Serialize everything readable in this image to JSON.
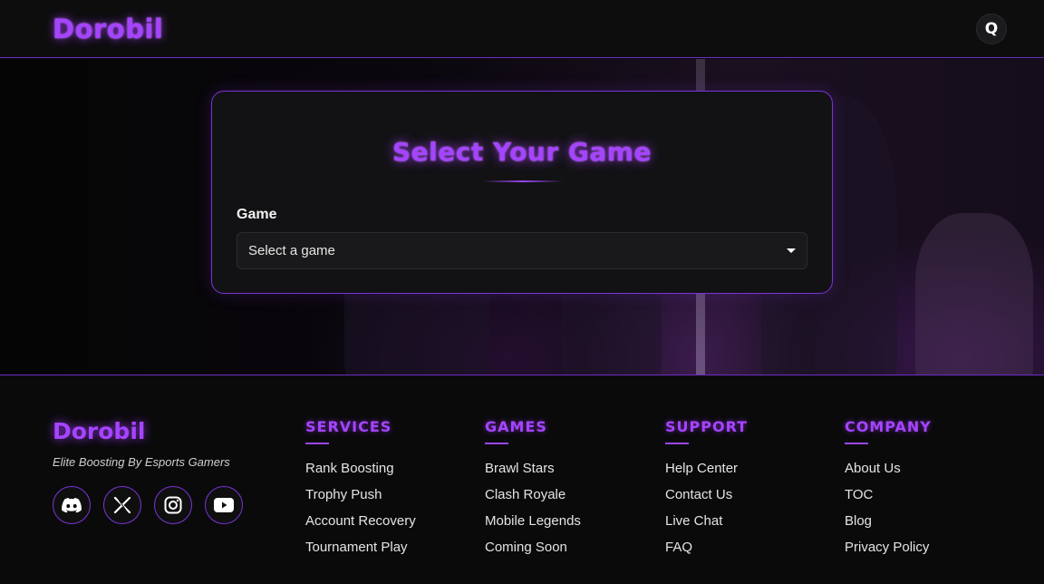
{
  "header": {
    "logo": "Dorobil",
    "avatar_initial": "Q"
  },
  "selector": {
    "title": "Select Your Game",
    "field_label": "Game",
    "selected_value": "Select a game",
    "caret_icon": "caret-down-icon"
  },
  "footer": {
    "logo": "Dorobil",
    "tagline": "Elite Boosting By Esports Gamers",
    "socials": [
      {
        "icon": "discord-icon"
      },
      {
        "icon": "x-twitter-icon"
      },
      {
        "icon": "instagram-icon"
      },
      {
        "icon": "youtube-icon"
      }
    ],
    "columns": [
      {
        "title": "SERVICES",
        "links": [
          "Rank Boosting",
          "Trophy Push",
          "Account Recovery",
          "Tournament Play"
        ]
      },
      {
        "title": "GAMES",
        "links": [
          "Brawl Stars",
          "Clash Royale",
          "Mobile Legends",
          "Coming Soon"
        ]
      },
      {
        "title": "SUPPORT",
        "links": [
          "Help Center",
          "Contact Us",
          "Live Chat",
          "FAQ"
        ]
      },
      {
        "title": "COMPANY",
        "links": [
          "About Us",
          "TOC",
          "Blog",
          "Privacy Policy"
        ]
      }
    ]
  },
  "colors": {
    "accent": "#a544ff",
    "border": "#7a34d6",
    "background": "#0b0b0c"
  }
}
